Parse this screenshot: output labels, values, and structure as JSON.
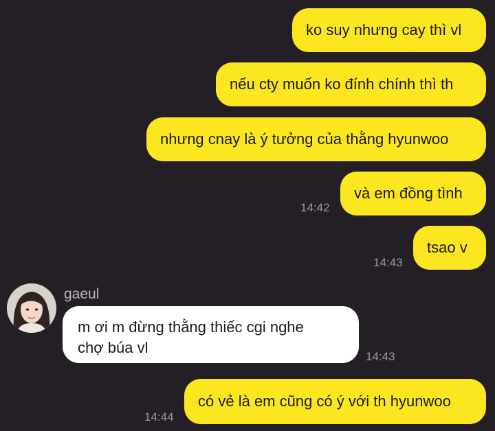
{
  "conversation": {
    "messages": [
      {
        "text": "ko suy nhưng cay thì vl"
      },
      {
        "text": "nếu cty muốn ko đính chính thì th"
      },
      {
        "text": "nhưng cnay là ý tưởng của thằng hyunwoo"
      },
      {
        "text": "và em đồng tình",
        "time": "14:42"
      },
      {
        "text": "tsao v",
        "time": "14:43"
      },
      {
        "sender": "gaeul",
        "lines": [
          "m ơi m đừng thằng thiếc cgi nghe",
          "chợ búa vl"
        ],
        "time": "14:43",
        "avatar_icon": "profile-photo-icon"
      },
      {
        "text": "có vẻ là em cũng có ý với th hyunwoo",
        "time": "14:44"
      }
    ]
  },
  "colors": {
    "background": "#231f24",
    "outgoing_bubble": "#fbe620",
    "incoming_bubble": "#ffffff",
    "timestamp": "#9c9aa0"
  }
}
